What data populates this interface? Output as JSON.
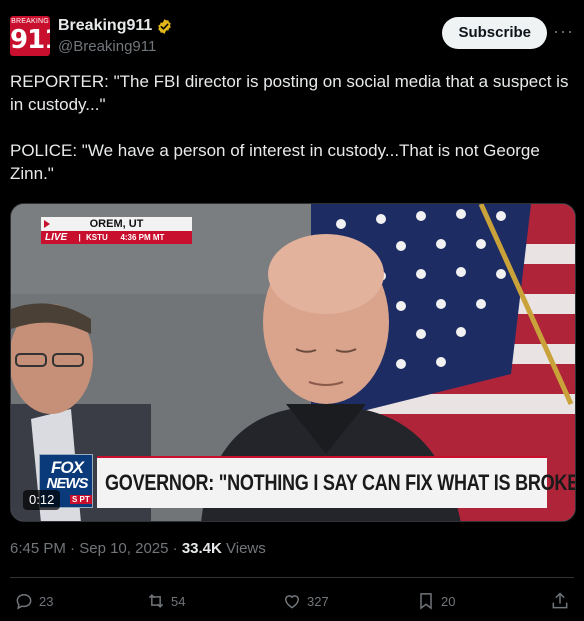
{
  "account": {
    "avatar_text_top": "BREAKING",
    "avatar_text_num": "911",
    "display_name": "Breaking911",
    "handle": "@Breaking911"
  },
  "header": {
    "subscribe_label": "Subscribe",
    "more_label": "···"
  },
  "post": {
    "paragraph_1": "REPORTER: \"The FBI director is posting on social media that a suspect is in custody...\"",
    "paragraph_2": "POLICE: \"We have a person of interest in custody...That is not George Zinn.\""
  },
  "media": {
    "location": "OREM, UT",
    "live": "LIVE",
    "station": "KSTU",
    "time": "4:36 PM MT",
    "chyron": "GOVERNOR: \"NOTHING I SAY CAN FIX WHAT IS BROKEN\"",
    "logo_line_1": "FOX",
    "logo_line_2": "NEWS",
    "logo_line_3": "S PT",
    "video_timestamp": "0:12"
  },
  "meta": {
    "time": "6:45 PM",
    "date": "Sep 10, 2025",
    "separator": "·",
    "views_count": "33.4K",
    "views_label": "Views"
  },
  "actions": {
    "replies": "23",
    "reposts": "54",
    "likes": "327",
    "bookmarks": "20"
  },
  "colors": {
    "background": "#000000",
    "text": "#e7e9ea",
    "muted": "#71767b",
    "verified_gold": "#e2b719",
    "fox_red": "#c8102e",
    "fox_blue": "#0b3a7a"
  },
  "icons": [
    "verified-badge-icon",
    "more-icon",
    "reply-icon",
    "repost-icon",
    "like-icon",
    "bookmark-icon",
    "share-icon"
  ]
}
